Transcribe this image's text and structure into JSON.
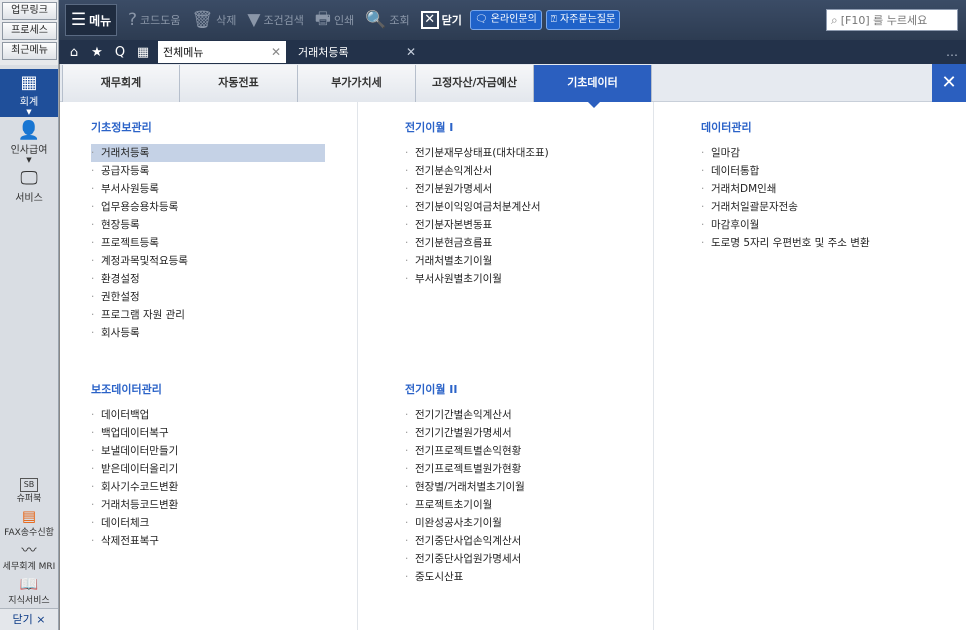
{
  "quick_buttons": [
    "업무링크",
    "프로세스",
    "최근메뉴"
  ],
  "side_nav": [
    {
      "label": "회계",
      "icon": "calculator-icon",
      "active": true
    },
    {
      "label": "인사급여",
      "icon": "person-icon",
      "active": false
    },
    {
      "label": "서비스",
      "icon": "monitor-icon",
      "active": false
    }
  ],
  "side_bottom": [
    {
      "label": "슈퍼북",
      "icon": "superbook-icon",
      "badge": "SB"
    },
    {
      "label": "FAX송수신함",
      "icon": "fax-icon"
    },
    {
      "label": "세무회계 MRI",
      "icon": "pulse-icon"
    },
    {
      "label": "지식서비스",
      "icon": "book-icon"
    }
  ],
  "side_close_label": "닫기 ×",
  "toolbar": {
    "menu_label": "메뉴",
    "items": [
      {
        "label": "코드도움",
        "icon": "question-icon",
        "enabled": false
      },
      {
        "label": "삭제",
        "icon": "trash-icon",
        "enabled": false
      },
      {
        "label": "조건검색",
        "icon": "filter-icon",
        "enabled": false
      },
      {
        "label": "인쇄",
        "icon": "printer-icon",
        "enabled": false
      },
      {
        "label": "조회",
        "icon": "magnifier-icon",
        "enabled": false
      },
      {
        "label": "닫기",
        "icon": "close-box-icon",
        "enabled": true
      }
    ],
    "online_inquiry": "온라인문의",
    "faq": "자주묻는질문",
    "search_placeholder": "[F10] 를 누르세요"
  },
  "tabs": {
    "active": "전체메뉴",
    "inactive": "거래처등록"
  },
  "categories": [
    {
      "label": "재무회계",
      "active": false
    },
    {
      "label": "자동전표",
      "active": false
    },
    {
      "label": "부가가치세",
      "active": false
    },
    {
      "label": "고정자산/자금예산",
      "active": false
    },
    {
      "label": "기초데이터",
      "active": true
    }
  ],
  "groups": {
    "basic_info": {
      "title": "기초정보관리",
      "items": [
        "거래처등록",
        "공급자등록",
        "부서사원등록",
        "업무용승용차등록",
        "현장등록",
        "프로젝트등록",
        "계정과목및적요등록",
        "환경설정",
        "권한설정",
        "프로그램 자원 관리",
        "회사등록"
      ]
    },
    "prior_1": {
      "title": "전기이월 I",
      "items": [
        "전기분재무상태표(대차대조표)",
        "전기분손익계산서",
        "전기분원가명세서",
        "전기분이익잉여금처분계산서",
        "전기분자본변동표",
        "전기분현금흐름표",
        "거래처별초기이월",
        "부서사원별초기이월"
      ]
    },
    "data_mgmt": {
      "title": "데이터관리",
      "items": [
        "일마감",
        "데이터통합",
        "거래처DM인쇄",
        "거래처일괄문자전송",
        "마감후이월",
        "도로명 5자리 우편번호 및 주소 변환"
      ]
    },
    "aux_data": {
      "title": "보조데이터관리",
      "items": [
        "데이터백업",
        "백업데이터복구",
        "보낼데이터만들기",
        "받은데이터올리기",
        "회사기수코드변환",
        "거래처등코드변환",
        "데이터체크",
        "삭제전표복구"
      ]
    },
    "prior_2": {
      "title": "전기이월 II",
      "items": [
        "전기기간별손익계산서",
        "전기기간별원가명세서",
        "전기프로젝트별손익현황",
        "전기프로젝트별원가현황",
        "현장별/거래처별초기이월",
        "프로젝트초기이월",
        "미완성공사초기이월",
        "전기중단사업손익계산서",
        "전기중단사업원가명세서",
        "중도시산표"
      ]
    }
  },
  "selected_item": "거래처등록"
}
